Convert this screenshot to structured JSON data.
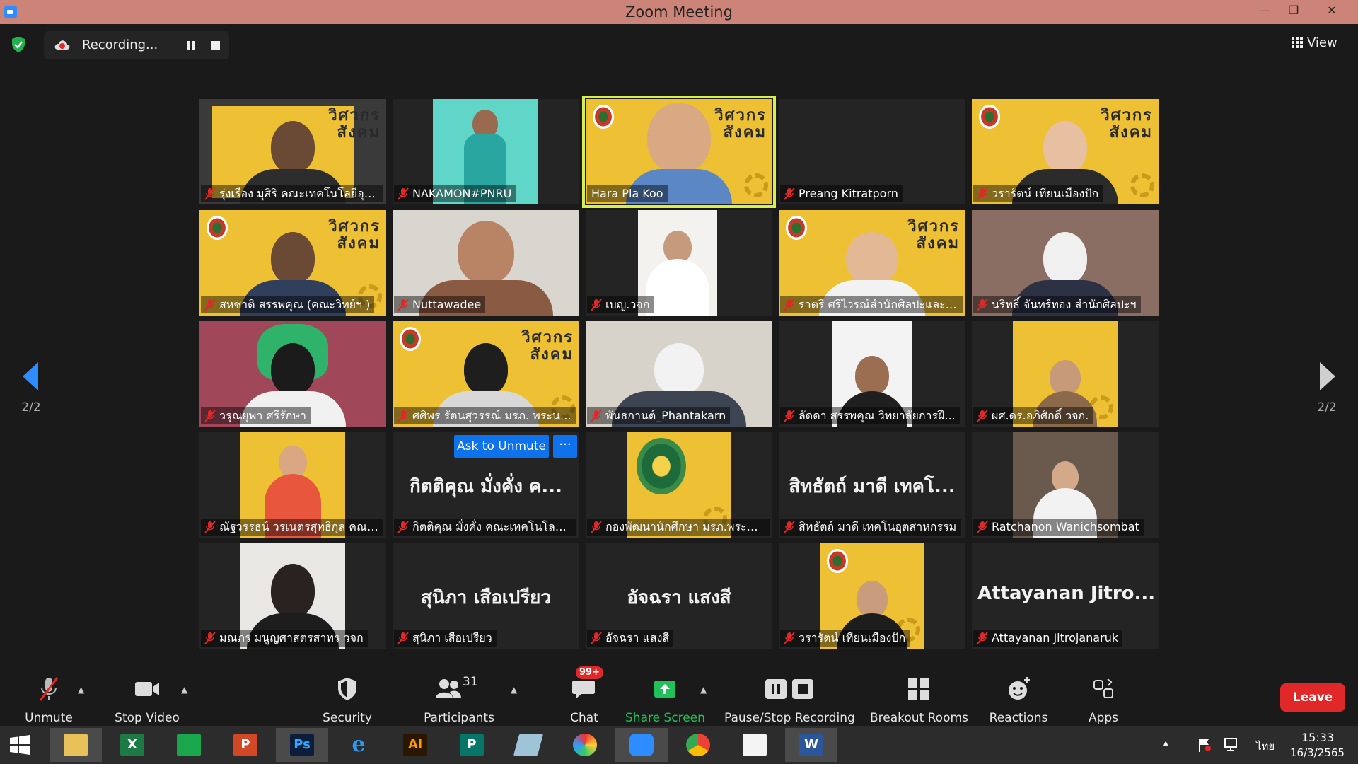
{
  "window": {
    "title": "Zoom Meeting",
    "minimize": "—",
    "restore": "❒",
    "close": "✕"
  },
  "recording": {
    "label": "Recording..."
  },
  "view": {
    "label": "View"
  },
  "pager": {
    "left": "2/2",
    "right": "2/2"
  },
  "tiles": [
    "รุ่งเรือง มุสิริ คณะเทคโนโลยีอุตส...",
    "NAKAMON#PNRU",
    "Hara Pla Koo",
    "Preang Kitratporn",
    "วรารัตน์ เทียนเมืองปัก",
    "สหชาติ สรรพคุณ (คณะวิทย์ฯ )",
    "Nuttawadee",
    "เบญ.วจก",
    "ราตรี ศรีไวรณ์สำนักศิลปะและวั...",
    "นริทธิ์ จันทร์ทอง สำนักศิลปะฯ",
    "วรุณยุพา ศรีรักษา",
    "ศศิพร รัตนสุวรรณ์ มรภ. พระนคร",
    "พันธกานต์_Phantakarn",
    "ลัดดา สรรพคุณ วิทยาลัยการฝึ...",
    "ผศ.ดร.อภิศักดิ์ วจก.",
    "ณัฐวรรธน์ วรเนตรสุทธิกุล คณะเ...",
    "กิตติคุณ มั่งคั่ง คณะเทคโนโลยีอ...",
    "กองพัฒนานักศึกษา มรภ.พระนคร",
    "สิทธัตถ์ มาดี เทคโนอุตสาหกรรม",
    "Ratchanon Wanichsombat",
    "มณภร มนูญศาสตรสาทร วจก",
    "สุนิภา เสือเปรียว",
    "อัจฉรา แสงสี",
    "วรารัตน์ เทียนเมืองปัก",
    "Attayanan Jitrojanaruk"
  ],
  "big_names": {
    "t16": "กิตติคุณ มั่งคั่ง ค...",
    "t18": "สิทธัตถ์ มาดี เทคโ...",
    "t21": "สุนิภา เสือเปรียว",
    "t22": "อัจฉรา แสงสี",
    "t24": "Attayanan Jitro..."
  },
  "poster_title": "วิศวกร\nสังคม",
  "hover": {
    "ask_unmute": "Ask to Unmute",
    "more": "···"
  },
  "toolbar": {
    "unmute": "Unmute",
    "stop_video": "Stop Video",
    "security": "Security",
    "participants": "Participants",
    "participants_count": "31",
    "chat": "Chat",
    "chat_badge": "99+",
    "share_screen": "Share Screen",
    "pause_stop": "Pause/Stop Recording",
    "breakout": "Breakout Rooms",
    "reactions": "Reactions",
    "apps": "Apps",
    "leave": "Leave"
  },
  "taskbar": {
    "apps": [
      "File Explorer",
      "Excel",
      "Store",
      "PowerPoint",
      "Photoshop",
      "Internet Explorer",
      "Illustrator",
      "Publisher",
      "Notes",
      "PhotoScape",
      "Zoom",
      "Chrome",
      "Photos",
      "Word"
    ],
    "app_letters": [
      "",
      "X",
      "",
      "P",
      "Ps",
      "e",
      "Ai",
      "P",
      "",
      "",
      "",
      "",
      "",
      "W"
    ],
    "lang": "ไทย",
    "time": "15:33",
    "date": "16/3/2565",
    "tray_up": "▴"
  },
  "colors": {
    "speaking_outline": "#d6ef4a",
    "accent_blue": "#0e72ed",
    "leave_red": "#e02828",
    "share_green": "#21c15a",
    "poster_yellow": "#eec033"
  }
}
